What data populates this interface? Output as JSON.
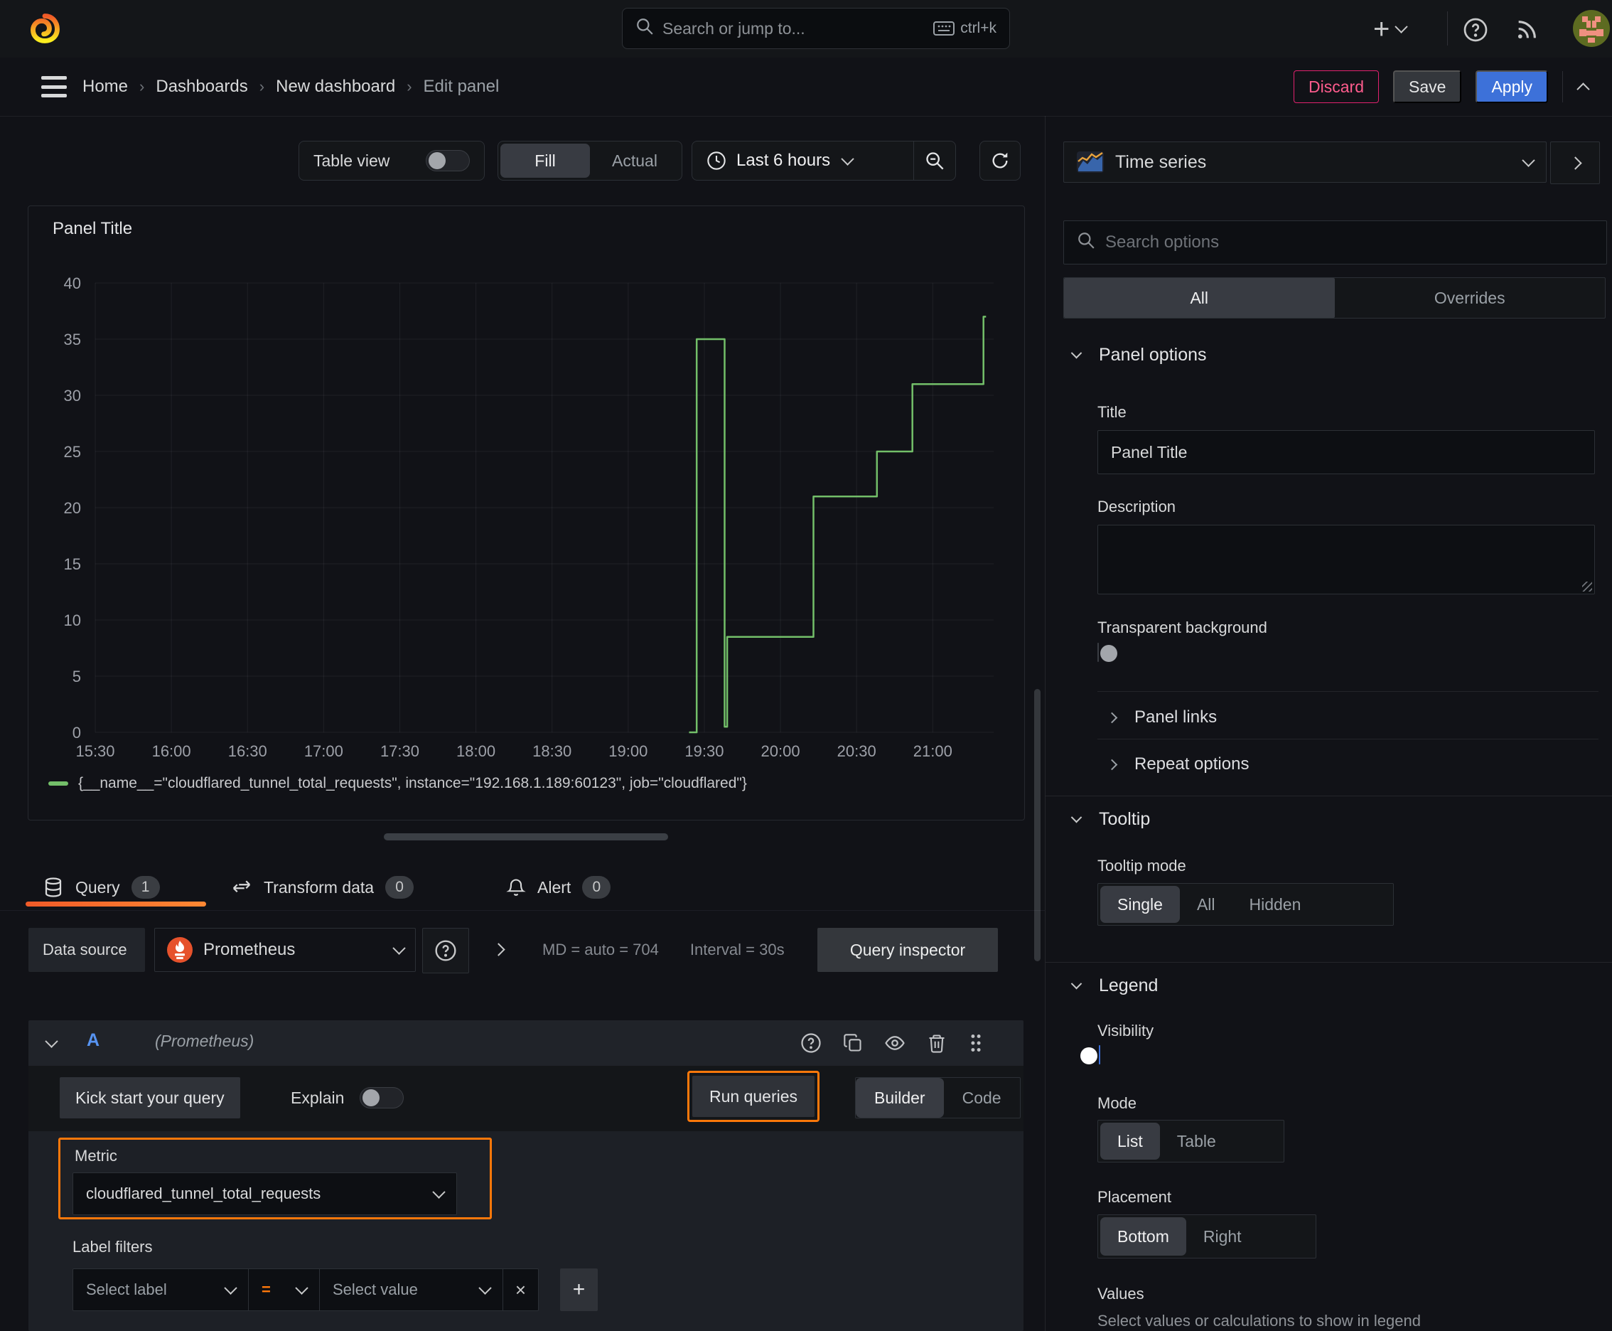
{
  "colors": {
    "accent_orange": "#ff780a",
    "primary_blue": "#3d71d9",
    "series_green": "#73bf69",
    "destructive_pink": "#e0226e",
    "query_letter_blue": "#5794f2"
  },
  "topbar": {
    "search_placeholder": "Search or jump to...",
    "search_shortcut": "ctrl+k"
  },
  "breadcrumb": {
    "items": [
      {
        "label": "Home"
      },
      {
        "label": "Dashboards"
      },
      {
        "label": "New dashboard"
      },
      {
        "label": "Edit panel"
      }
    ],
    "discard_label": "Discard",
    "save_label": "Save",
    "apply_label": "Apply"
  },
  "viz_toolbar": {
    "table_view_label": "Table view",
    "fill_label": "Fill",
    "actual_label": "Actual",
    "time_range_label": "Last 6 hours"
  },
  "panel": {
    "title": "Panel Title"
  },
  "chart_data": {
    "type": "line",
    "title": "Panel Title",
    "xlabel": "",
    "ylabel": "",
    "x_domain": [
      "15:30",
      "21:24"
    ],
    "x_ticks": [
      "15:30",
      "16:00",
      "16:30",
      "17:00",
      "17:30",
      "18:00",
      "18:30",
      "19:00",
      "19:30",
      "20:00",
      "20:30",
      "21:00"
    ],
    "ylim": [
      0,
      40
    ],
    "y_ticks": [
      0,
      5,
      10,
      15,
      20,
      25,
      30,
      35,
      40
    ],
    "grid": true,
    "legend_position": "bottom",
    "series": [
      {
        "name": "{__name__=\"cloudflared_tunnel_total_requests\", instance=\"192.168.1.189:60123\", job=\"cloudflared\"}",
        "color": "#73bf69",
        "points": [
          [
            "19:24",
            0
          ],
          [
            "19:27",
            0
          ],
          [
            "19:27",
            35
          ],
          [
            "19:38",
            35
          ],
          [
            "19:38",
            0.5
          ],
          [
            "19:39",
            0.5
          ],
          [
            "19:39",
            8.5
          ],
          [
            "20:13",
            8.5
          ],
          [
            "20:13",
            21
          ],
          [
            "20:38",
            21
          ],
          [
            "20:38",
            25
          ],
          [
            "20:52",
            25
          ],
          [
            "20:52",
            31
          ],
          [
            "21:20",
            31
          ],
          [
            "21:20",
            37
          ],
          [
            "21:21",
            37
          ]
        ]
      }
    ]
  },
  "editor_tabs": {
    "query_label": "Query",
    "query_count": "1",
    "transform_label": "Transform data",
    "transform_count": "0",
    "alert_label": "Alert",
    "alert_count": "0"
  },
  "datasource_row": {
    "label": "Data source",
    "name": "Prometheus",
    "stat_md": "MD = auto = 704",
    "stat_interval": "Interval = 30s",
    "inspector_label": "Query inspector"
  },
  "query_editor": {
    "ref_id": "A",
    "ds_hint": "(Prometheus)",
    "kick_start_label": "Kick start your query",
    "explain_label": "Explain",
    "run_label": "Run queries",
    "builder_label": "Builder",
    "code_label": "Code",
    "metric_label": "Metric",
    "metric_value": "cloudflared_tunnel_total_requests",
    "label_filters_label": "Label filters",
    "select_label_placeholder": "Select label",
    "operator": "=",
    "select_value_placeholder": "Select value",
    "remove_filter": "×",
    "add_filter": "+"
  },
  "sidebar": {
    "viz_type": "Time series",
    "search_placeholder": "Search options",
    "tab_all": "All",
    "tab_overrides": "Overrides",
    "panel_options": {
      "header": "Panel options",
      "title_label": "Title",
      "title_value": "Panel Title",
      "description_label": "Description",
      "transparent_label": "Transparent background",
      "links_label": "Panel links",
      "repeat_label": "Repeat options"
    },
    "tooltip": {
      "header": "Tooltip",
      "mode_label": "Tooltip mode",
      "options": [
        "Single",
        "All",
        "Hidden"
      ],
      "selected": "Single"
    },
    "legend": {
      "header": "Legend",
      "visibility_label": "Visibility",
      "mode_label": "Mode",
      "mode_options": [
        "List",
        "Table"
      ],
      "placement_label": "Placement",
      "placement_options": [
        "Bottom",
        "Right"
      ],
      "values_label": "Values",
      "values_help": "Select values or calculations to show in legend"
    }
  }
}
